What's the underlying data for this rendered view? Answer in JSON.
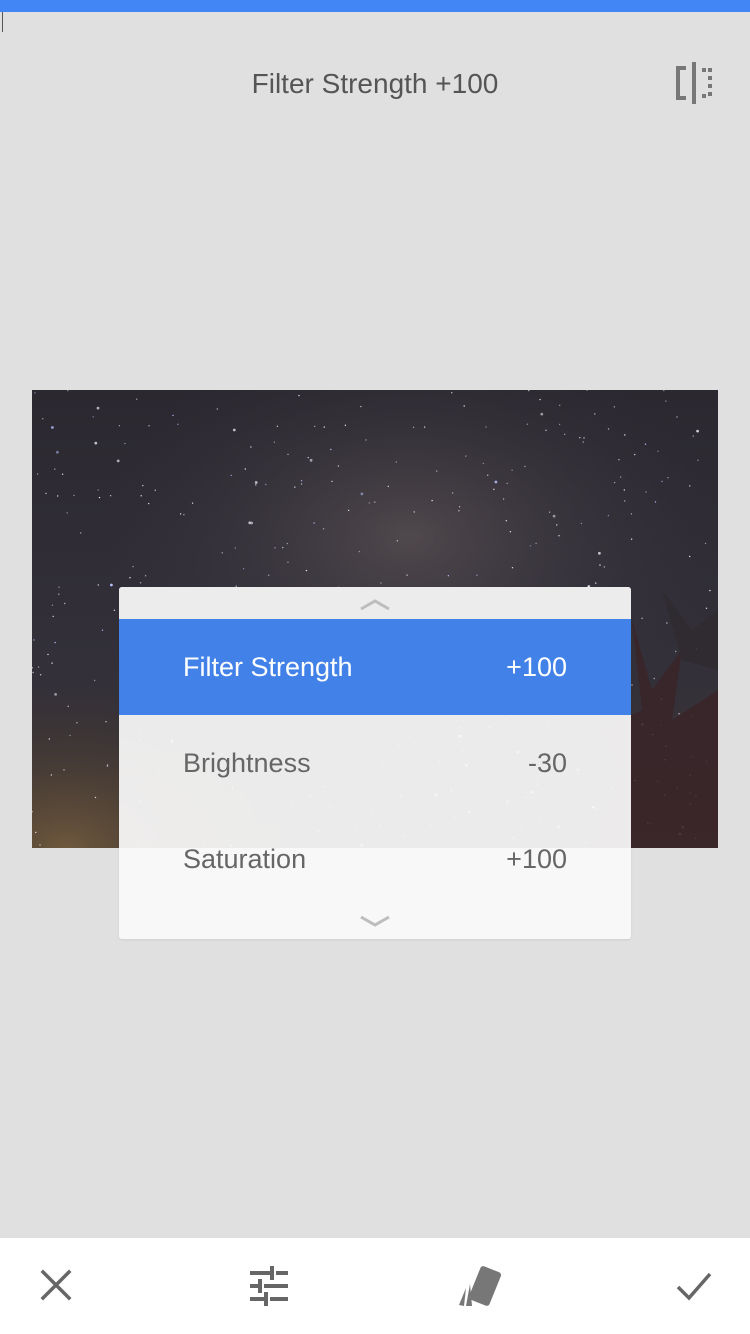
{
  "header": {
    "title": "Filter Strength +100",
    "compare_icon": "compare-split-icon"
  },
  "adjust_menu": {
    "scroll_up_icon": "chevron-up-icon",
    "scroll_down_icon": "chevron-down-icon",
    "items": [
      {
        "label": "Filter Strength",
        "value": "+100",
        "selected": true
      },
      {
        "label": "Brightness",
        "value": "-30",
        "selected": false
      },
      {
        "label": "Saturation",
        "value": "+100",
        "selected": false
      }
    ]
  },
  "bottom_bar": {
    "cancel_icon": "close-icon",
    "adjust_icon": "tune-sliders-icon",
    "styles_icon": "style-cards-icon",
    "apply_icon": "checkmark-icon"
  },
  "colors": {
    "accent": "#4285f4",
    "selected_row": "#4282e8",
    "background": "#e0e0e0",
    "text": "#555555"
  }
}
